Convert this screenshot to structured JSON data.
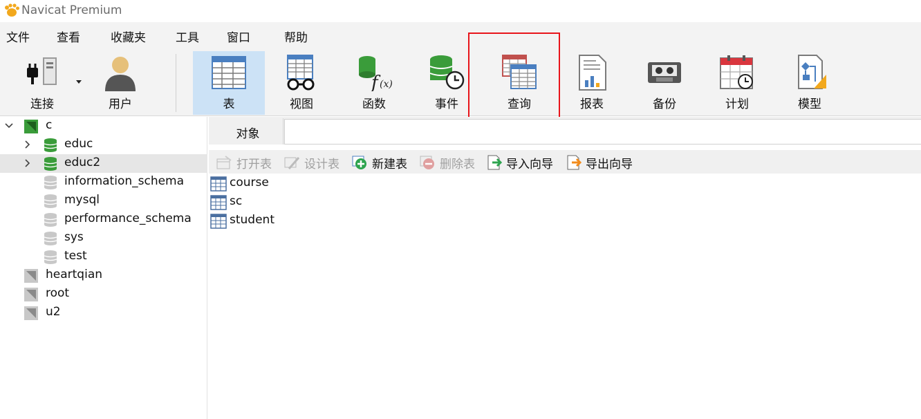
{
  "window": {
    "title": "Navicat Premium"
  },
  "menu": [
    "文件",
    "查看",
    "收藏夹",
    "工具",
    "窗口",
    "帮助"
  ],
  "toolbar": {
    "items": [
      {
        "label": "连接",
        "icon": "connection-plug-icon"
      },
      {
        "label": "用户",
        "icon": "user-icon"
      },
      {
        "label": "表",
        "icon": "table-icon",
        "active": true
      },
      {
        "label": "视图",
        "icon": "view-glasses-icon"
      },
      {
        "label": "函数",
        "icon": "function-icon"
      },
      {
        "label": "事件",
        "icon": "event-clock-icon"
      },
      {
        "label": "查询",
        "icon": "query-icon"
      },
      {
        "label": "报表",
        "icon": "report-icon"
      },
      {
        "label": "备份",
        "icon": "backup-tape-icon"
      },
      {
        "label": "计划",
        "icon": "schedule-calendar-icon"
      },
      {
        "label": "模型",
        "icon": "model-icon"
      }
    ]
  },
  "tree": {
    "nodes": [
      {
        "label": "c",
        "type": "connection",
        "expanded": true,
        "active": true
      },
      {
        "label": "educ",
        "type": "database",
        "active": true
      },
      {
        "label": "educ2",
        "type": "database",
        "active": true,
        "selected": true
      },
      {
        "label": "information_schema",
        "type": "database",
        "active": false
      },
      {
        "label": "mysql",
        "type": "database",
        "active": false
      },
      {
        "label": "performance_schema",
        "type": "database",
        "active": false
      },
      {
        "label": "sys",
        "type": "database",
        "active": false
      },
      {
        "label": "test",
        "type": "database",
        "active": false
      },
      {
        "label": "heartqian",
        "type": "connection",
        "active": false
      },
      {
        "label": "root",
        "type": "connection",
        "active": false
      },
      {
        "label": "u2",
        "type": "connection",
        "active": false
      }
    ]
  },
  "tabs": {
    "objects": "对象"
  },
  "object_toolbar": {
    "open": "打开表",
    "design": "设计表",
    "new": "新建表",
    "delete": "删除表",
    "import": "导入向导",
    "export": "导出向导"
  },
  "objects": [
    "course",
    "sc",
    "student"
  ],
  "colors": {
    "highlight": "#e8141a",
    "active_tab": "#cce2f6",
    "db_green": "#3a9c3a"
  }
}
